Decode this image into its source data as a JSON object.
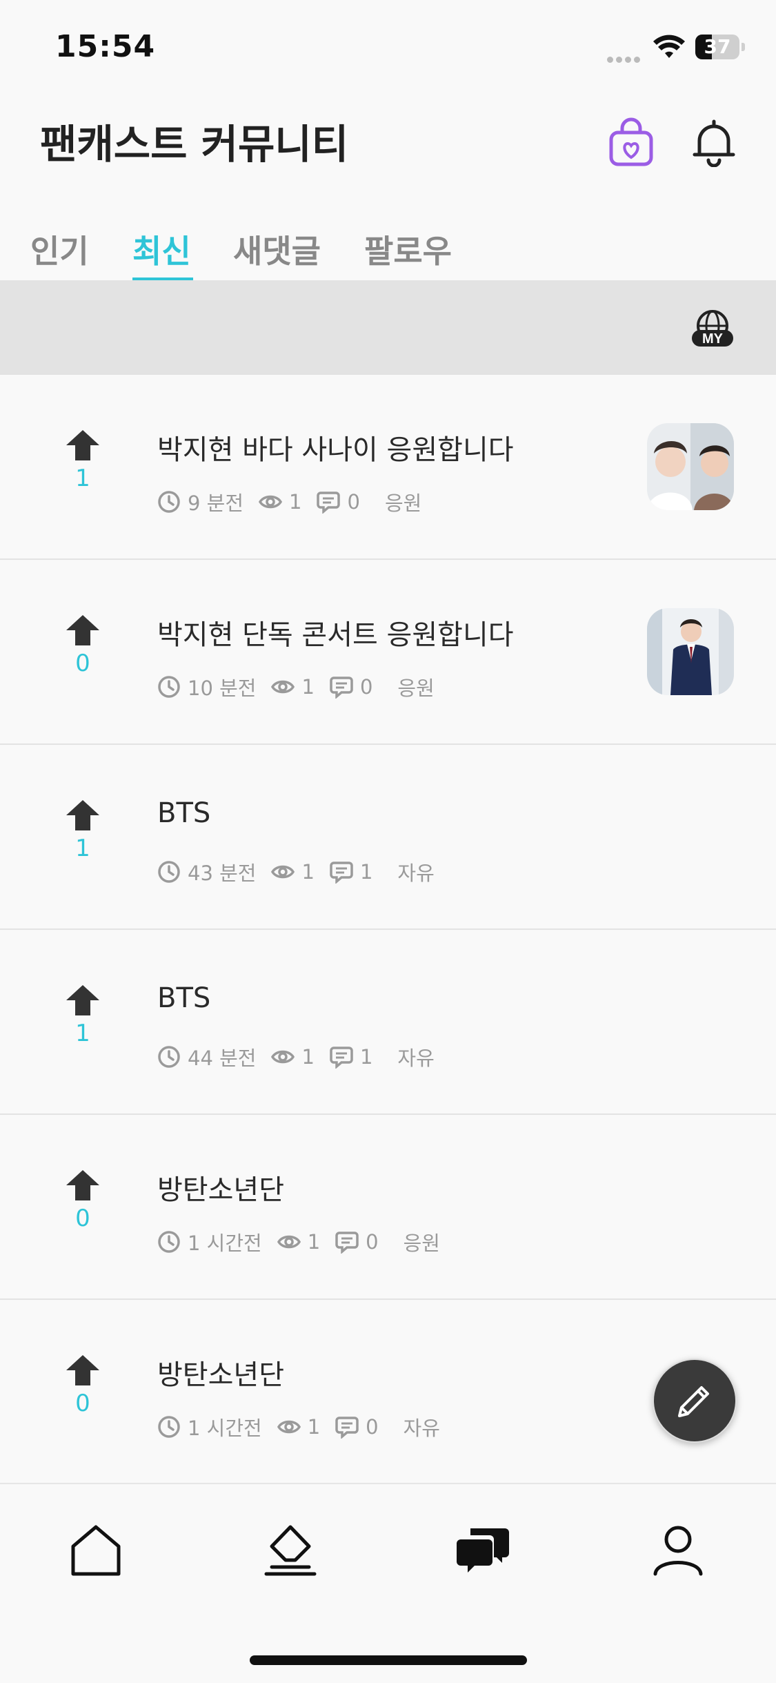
{
  "status_bar": {
    "time": "15:54",
    "battery": "37",
    "battery_level": 0.37
  },
  "header": {
    "title": "팬캐스트 커뮤니티",
    "icons": [
      "shopping-bag-heart-icon",
      "bell-icon"
    ]
  },
  "tabs": [
    {
      "label": "인기",
      "active": false
    },
    {
      "label": "최신",
      "active": true
    },
    {
      "label": "새댓글",
      "active": false
    },
    {
      "label": "팔로우",
      "active": false
    }
  ],
  "filter_bar": {
    "icon": "my-globe-icon",
    "icon_text": "MY"
  },
  "posts": [
    {
      "votes": "1",
      "title": "박지현 바다 사나이 응원합니다",
      "time": "9 분전",
      "views": "1",
      "comments": "0",
      "category": "응원",
      "has_thumbnail": true
    },
    {
      "votes": "0",
      "title": "박지현 단독 콘서트 응원합니다",
      "time": "10 분전",
      "views": "1",
      "comments": "0",
      "category": "응원",
      "has_thumbnail": true
    },
    {
      "votes": "1",
      "title": "BTS",
      "time": "43 분전",
      "views": "1",
      "comments": "1",
      "category": "자유",
      "has_thumbnail": false
    },
    {
      "votes": "1",
      "title": "BTS",
      "time": "44 분전",
      "views": "1",
      "comments": "1",
      "category": "자유",
      "has_thumbnail": false
    },
    {
      "votes": "0",
      "title": "방탄소년단",
      "time": "1 시간전",
      "views": "1",
      "comments": "0",
      "category": "응원",
      "has_thumbnail": false
    },
    {
      "votes": "0",
      "title": "방탄소년단",
      "time": "1 시간전",
      "views": "1",
      "comments": "0",
      "category": "자유",
      "has_thumbnail": false
    }
  ],
  "fab": {
    "icon": "pencil-icon"
  },
  "bottom_nav": [
    {
      "icon": "home-icon",
      "active": false
    },
    {
      "icon": "eraser-icon",
      "active": false
    },
    {
      "icon": "chat-bubbles-icon",
      "active": true
    },
    {
      "icon": "person-icon",
      "active": false
    }
  ],
  "colors": {
    "accent": "#2ec4d7",
    "bag": "#9b5de5",
    "background": "#f9f9f9",
    "filter_bar": "#e3e3e3"
  }
}
